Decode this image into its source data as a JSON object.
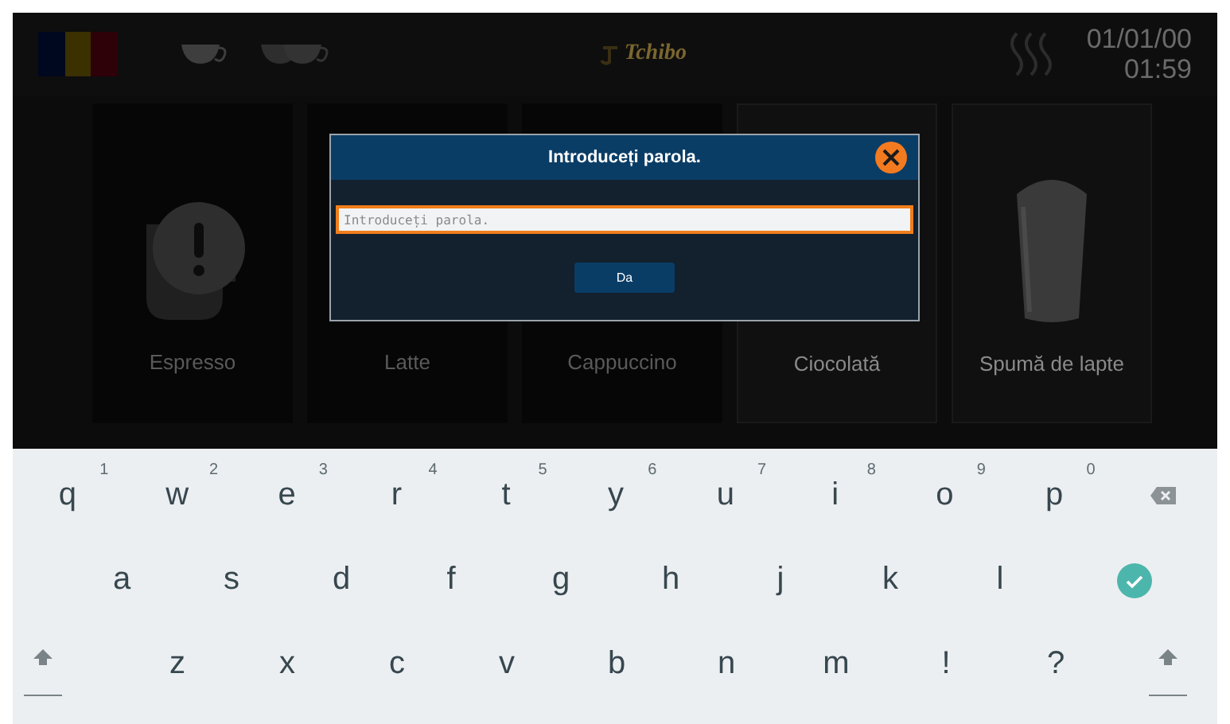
{
  "top_bar": {
    "logo": "Tchibo",
    "date": "01/01/00",
    "time": "01:59"
  },
  "tiles": [
    {
      "name": "Espresso",
      "available": false,
      "warning": true
    },
    {
      "name": "Latte",
      "available": false,
      "warning": false
    },
    {
      "name": "Cappuccino",
      "available": false,
      "warning": false
    },
    {
      "name": "Ciocolată",
      "available": true,
      "warning": false
    },
    {
      "name": "Spumă de lapte",
      "available": true,
      "warning": false
    }
  ],
  "dialog": {
    "title": "Introduceți parola.",
    "field": {
      "placeholder": "Introduceți parola.",
      "focused": true
    },
    "button": "Da"
  },
  "keyboard": {
    "rows": [
      [
        {
          "kind": "letter",
          "label": "q",
          "hint": "1"
        },
        {
          "kind": "letter",
          "label": "w",
          "hint": "2"
        },
        {
          "kind": "letter",
          "label": "e",
          "hint": "3"
        },
        {
          "kind": "letter",
          "label": "r",
          "hint": "4"
        },
        {
          "kind": "letter",
          "label": "t",
          "hint": "5"
        },
        {
          "kind": "letter",
          "label": "y",
          "hint": "6"
        },
        {
          "kind": "letter",
          "label": "u",
          "hint": "7"
        },
        {
          "kind": "letter",
          "label": "i",
          "hint": "8"
        },
        {
          "kind": "letter",
          "label": "o",
          "hint": "9"
        },
        {
          "kind": "letter",
          "label": "p",
          "hint": "0"
        },
        {
          "kind": "backspace"
        }
      ],
      [
        {
          "kind": "spacer"
        },
        {
          "kind": "letter",
          "label": "a"
        },
        {
          "kind": "letter",
          "label": "s"
        },
        {
          "kind": "letter",
          "label": "d"
        },
        {
          "kind": "letter",
          "label": "f"
        },
        {
          "kind": "letter",
          "label": "g"
        },
        {
          "kind": "letter",
          "label": "h"
        },
        {
          "kind": "letter",
          "label": "j"
        },
        {
          "kind": "letter",
          "label": "k"
        },
        {
          "kind": "letter",
          "label": "l"
        },
        {
          "kind": "enter"
        }
      ],
      [
        {
          "kind": "shift"
        },
        {
          "kind": "letter",
          "label": "z"
        },
        {
          "kind": "letter",
          "label": "x"
        },
        {
          "kind": "letter",
          "label": "c"
        },
        {
          "kind": "letter",
          "label": "v"
        },
        {
          "kind": "letter",
          "label": "b"
        },
        {
          "kind": "letter",
          "label": "n"
        },
        {
          "kind": "letter",
          "label": "m"
        },
        {
          "kind": "letter",
          "label": "!"
        },
        {
          "kind": "letter",
          "label": "?"
        },
        {
          "kind": "shift"
        }
      ]
    ]
  }
}
